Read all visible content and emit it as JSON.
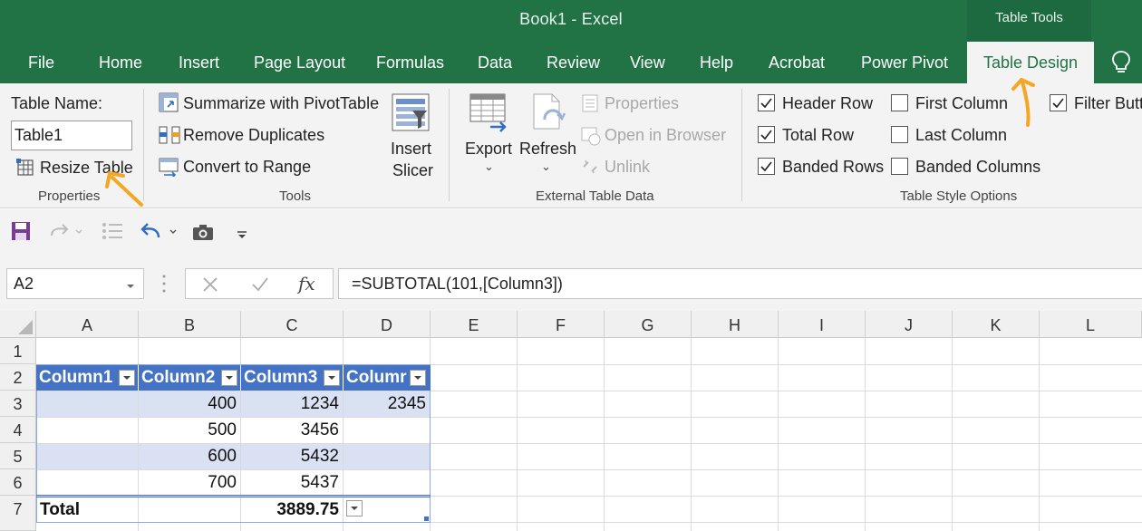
{
  "window": {
    "title": "Book1  -  Excel",
    "contextual_tab_group": "Table Tools"
  },
  "tabs": [
    {
      "label": "File"
    },
    {
      "label": "Home"
    },
    {
      "label": "Insert"
    },
    {
      "label": "Page Layout"
    },
    {
      "label": "Formulas"
    },
    {
      "label": "Data"
    },
    {
      "label": "Review"
    },
    {
      "label": "View"
    },
    {
      "label": "Help"
    },
    {
      "label": "Acrobat"
    },
    {
      "label": "Power Pivot"
    },
    {
      "label": "Table Design",
      "active": true
    }
  ],
  "ribbon": {
    "properties": {
      "table_name_label": "Table Name:",
      "table_name_value": "Table1",
      "resize_label": "Resize Table",
      "group_label": "Properties"
    },
    "tools": {
      "summarize_label": "Summarize with PivotTable",
      "remove_duplicates_label": "Remove Duplicates",
      "convert_label": "Convert to Range",
      "slicer_line1": "Insert",
      "slicer_line2": "Slicer",
      "group_label": "Tools"
    },
    "external": {
      "export_label": "Export",
      "refresh_label": "Refresh",
      "properties_label": "Properties",
      "open_browser_label": "Open in Browser",
      "unlink_label": "Unlink",
      "group_label": "External Table Data"
    },
    "style_options": {
      "header_row": {
        "label": "Header Row",
        "checked": true
      },
      "total_row": {
        "label": "Total Row",
        "checked": true
      },
      "banded_rows": {
        "label": "Banded Rows",
        "checked": true
      },
      "first_column": {
        "label": "First Column",
        "checked": false
      },
      "last_column": {
        "label": "Last Column",
        "checked": false
      },
      "banded_columns": {
        "label": "Banded Columns",
        "checked": false
      },
      "filter_button": {
        "label": "Filter Butt",
        "checked": true
      },
      "group_label": "Table Style Options"
    }
  },
  "formula_bar": {
    "name_box": "A2",
    "formula": "=SUBTOTAL(101,[Column3])",
    "fx_label": "fx"
  },
  "grid": {
    "columns": [
      "A",
      "B",
      "C",
      "D",
      "E",
      "F",
      "G",
      "H",
      "I",
      "J",
      "K",
      "L"
    ],
    "rows": [
      "1",
      "2",
      "3",
      "4",
      "5",
      "6",
      "7"
    ],
    "table_headers": [
      "Column1",
      "Column2",
      "Column3",
      "Columr"
    ],
    "cells": {
      "B3": "400",
      "C3": "1234",
      "D3": "2345",
      "B4": "500",
      "C4": "3456",
      "B5": "600",
      "C5": "5432",
      "B6": "700",
      "C6": "5437",
      "A7": "Total",
      "C7": "3889.75"
    }
  },
  "colors": {
    "excel_green": "#217346",
    "table_header_blue": "#4472c4",
    "table_band": "#d9e1f2",
    "annotation_orange": "#f5a623"
  }
}
